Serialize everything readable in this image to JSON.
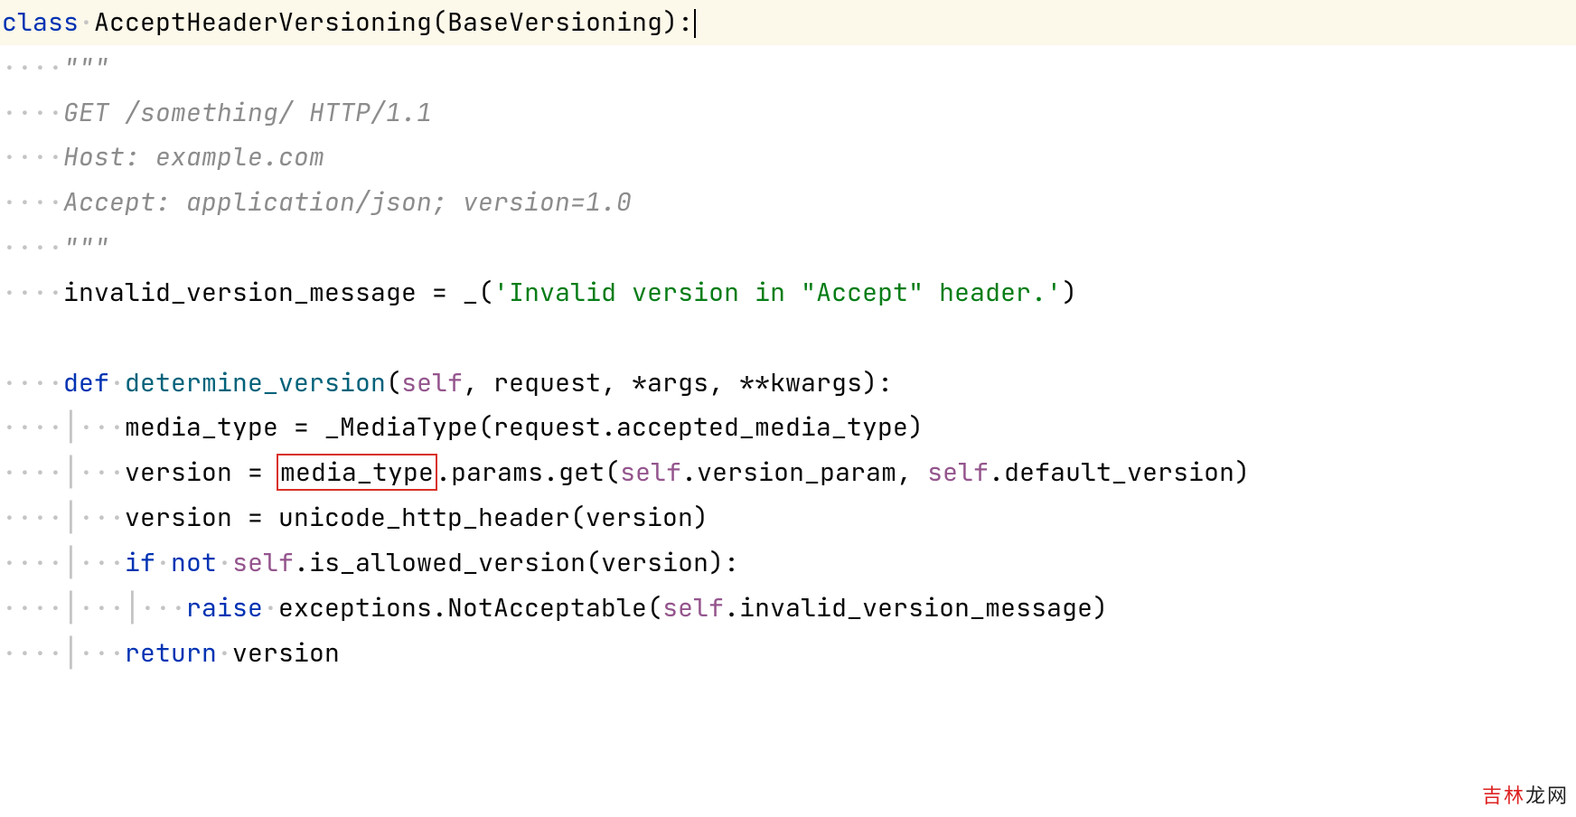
{
  "code": {
    "line1": {
      "kw_class": "class",
      "class_name": "AcceptHeaderVersioning",
      "base": "BaseVersioning"
    },
    "line2": {
      "docq": "\"\"\""
    },
    "line3": {
      "text": "GET /something/ HTTP/1.1"
    },
    "line4": {
      "text": "Host: example.com"
    },
    "line5": {
      "text": "Accept: application/json; version=1.0"
    },
    "line6": {
      "docq": "\"\"\""
    },
    "line7": {
      "var": "invalid_version_message",
      "eq": " = ",
      "fn": "_",
      "str": "'Invalid version in \"Accept\" header.'"
    },
    "line8": {
      "kw_def": "def",
      "fn_name": "determine_version",
      "self": "self",
      "rest_params": ", request, *args, **kwargs):"
    },
    "line9": {
      "var": "media_type",
      "eq": " = ",
      "call": "_MediaType(request.accepted_media_type)"
    },
    "line10": {
      "var": "version",
      "eq": " = ",
      "boxed": "media_type",
      "after_box": ".params.get(",
      "self1": "self",
      "mid": ".version_param, ",
      "self2": "self",
      "tail": ".default_version)"
    },
    "line11": {
      "var": "version",
      "eq": " = ",
      "call": "unicode_http_header(version)"
    },
    "line12": {
      "kw_if": "if",
      "kw_not": "not",
      "self": "self",
      "tail": ".is_allowed_version(version):"
    },
    "line13": {
      "kw_raise": "raise",
      "pre": "exceptions.NotAcceptable(",
      "self": "self",
      "tail": ".invalid_version_message)"
    },
    "line14": {
      "kw_return": "return",
      "var": "version"
    }
  },
  "indent": {
    "dots4": "····",
    "dots8": "········",
    "dots12": "············",
    "bar8": "····│···",
    "bar12": "····│·······",
    "bar12b": "····│···│···"
  },
  "watermark": {
    "red": "吉林",
    "black": "龙网"
  }
}
